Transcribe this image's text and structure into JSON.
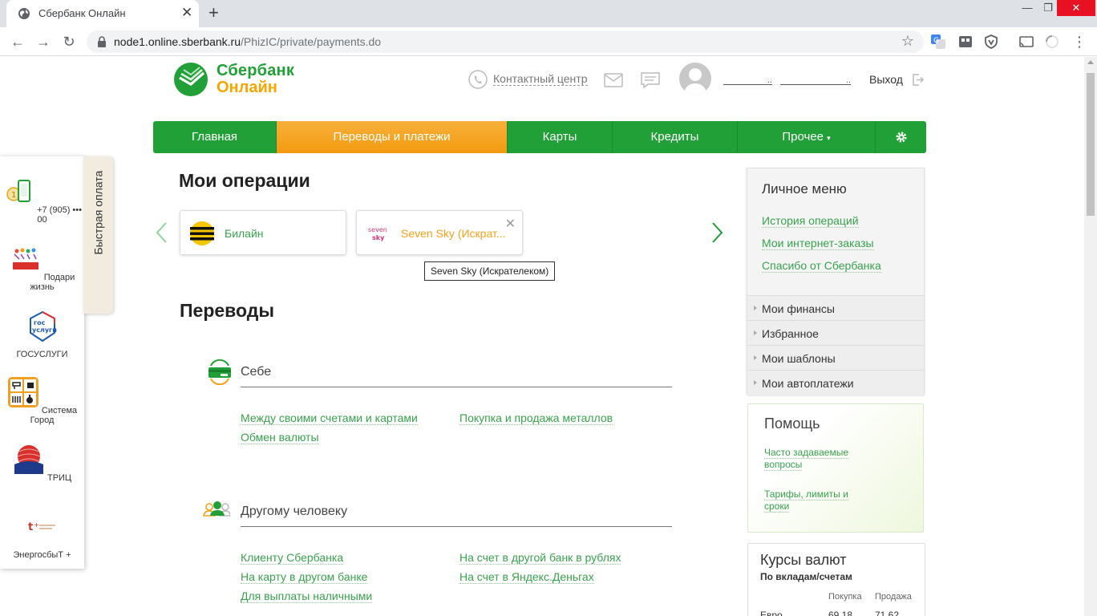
{
  "browser": {
    "tab_title": "Сбербанк Онлайн",
    "url_host": "node1.online.sberbank.ru",
    "url_path": "/PhizIC/private/payments.do"
  },
  "header": {
    "logo_line1": "Сбербанк",
    "logo_line2": "Онлайн",
    "contact_center": "Контактный центр",
    "user_name_dots": "..",
    "user_surname_dots": "..",
    "logout": "Выход"
  },
  "nav": {
    "items": [
      {
        "label": "Главная"
      },
      {
        "label": "Переводы и платежи"
      },
      {
        "label": "Карты"
      },
      {
        "label": "Кредиты"
      },
      {
        "label": "Прочее"
      }
    ],
    "more_caret": "▾"
  },
  "quick_pay": {
    "tab_label": "Быстрая оплата",
    "items": [
      {
        "label": "+7 (905) ••• 00"
      },
      {
        "label": "Подари жизнь"
      },
      {
        "label": "ГОСУСЛУГИ"
      },
      {
        "label": "Система Город"
      },
      {
        "label": "ТРИЦ"
      },
      {
        "label": "ЭнергосбыТ +"
      }
    ]
  },
  "operations": {
    "heading": "Мои операции",
    "cards": [
      {
        "label": "Билайн"
      },
      {
        "label": "Seven Sky (Искрат..."
      }
    ],
    "tooltip": "Seven Sky (Искрателеком)"
  },
  "transfers": {
    "heading": "Переводы",
    "self": {
      "title": "Себе",
      "links": [
        "Между своими счетами и картами",
        "Покупка и продажа металлов",
        "Обмен валюты"
      ]
    },
    "other": {
      "title": "Другому человеку",
      "links": [
        "Клиенту Сбербанка",
        "На счет в другой банк в рублях",
        "На карту в другом банке",
        "На счет в Яндекс.Деньгах",
        "Для выплаты наличными"
      ]
    }
  },
  "side_menu": {
    "title": "Личное меню",
    "links": [
      "История операций",
      "Мои интернет-заказы",
      "Спасибо от Сбербанка"
    ],
    "rows": [
      "Мои финансы",
      "Избранное",
      "Мои шаблоны",
      "Мои автоплатежи"
    ]
  },
  "help": {
    "title": "Помощь",
    "links": [
      "Часто задаваемые вопросы",
      "Тарифы, лимиты и сроки"
    ]
  },
  "rates": {
    "title": "Курсы валют",
    "subtitle": "По вкладам/счетам",
    "col_buy": "Покупка",
    "col_sell": "Продажа",
    "row_currency": "Евро",
    "row_buy": "69.18",
    "row_sell": "71.62"
  },
  "colors": {
    "brand_green": "#21a038",
    "brand_orange": "#f5a21b",
    "link_green": "#39a24e"
  }
}
